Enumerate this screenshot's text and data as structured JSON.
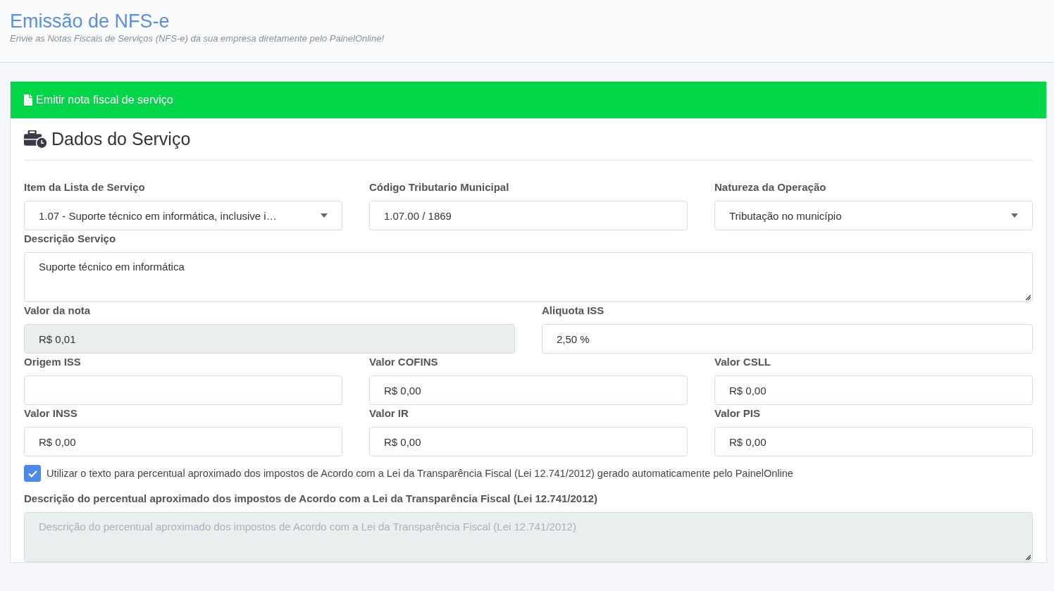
{
  "header": {
    "title": "Emissão de NFS-e",
    "subtitle": "Envie as Notas Fiscais de Serviços (NFS-e) da sua empresa diretamente pelo PainelOnline!"
  },
  "card": {
    "title": "Emitir nota fiscal de serviço"
  },
  "section": {
    "title": "Dados do Serviço"
  },
  "rows": [
    {
      "fields": [
        {
          "label": "Item da Lista de Serviço",
          "kind": "select",
          "value": "1.07 - Suporte técnico em informática, inclusive i…",
          "disabled": false
        },
        {
          "label": "Código Tributario Municipal",
          "kind": "text",
          "value": "1.07.00 / 1869",
          "disabled": false
        },
        {
          "label": "Natureza da Operação",
          "kind": "select",
          "value": "Tributação no município",
          "disabled": false
        }
      ]
    },
    {
      "fields": [
        {
          "label": "Descrição Serviço",
          "kind": "textarea",
          "value": "Suporte técnico em informática",
          "disabled": false
        }
      ]
    },
    {
      "fields": [
        {
          "label": "Valor da nota",
          "kind": "text",
          "value": "R$ 0,01",
          "disabled": true
        },
        {
          "label": "Aliquota ISS",
          "kind": "text",
          "value": "2,50 %",
          "disabled": false
        }
      ]
    },
    {
      "fields": [
        {
          "label": "Origem ISS",
          "kind": "text",
          "disabled": false
        },
        {
          "label": "Valor COFINS",
          "kind": "text",
          "value": "R$ 0,00",
          "disabled": false
        },
        {
          "label": "Valor CSLL",
          "kind": "text",
          "value": "R$ 0,00",
          "disabled": false
        }
      ]
    },
    {
      "fields": [
        {
          "label": "Valor INSS",
          "kind": "text",
          "value": "R$ 0,00",
          "disabled": false
        },
        {
          "label": "Valor IR",
          "kind": "text",
          "value": "R$ 0,00",
          "disabled": false
        },
        {
          "label": "Valor PIS",
          "kind": "text",
          "value": "R$ 0,00",
          "disabled": false
        }
      ]
    }
  ],
  "checkbox": {
    "label": "Utilizar o texto para percentual aproximado dos impostos de Acordo com a Lei da Transparência Fiscal (Lei 12.741/2012) gerado automaticamente pelo PainelOnline",
    "checked": true
  },
  "description_field": {
    "label": "Descrição do percentual aproximado dos impostos de Acordo com a Lei da Transparência Fiscal (Lei 12.741/2012)",
    "placeholder": "Descrição do percentual aproximado dos impostos de Acordo com a Lei da Transparência Fiscal (Lei 12.741/2012)",
    "disabled": true
  }
}
